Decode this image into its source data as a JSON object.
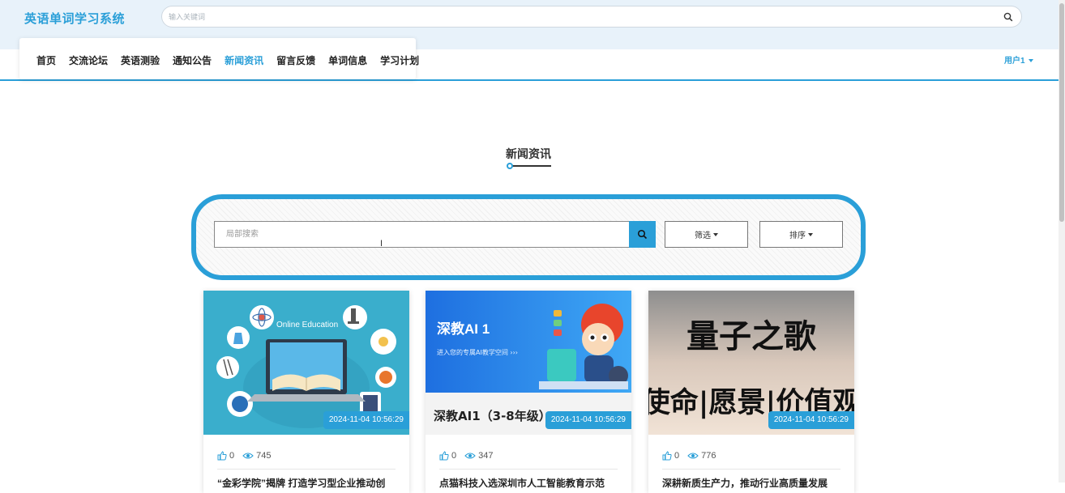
{
  "header": {
    "app_title": "英语单词学习系统",
    "search_placeholder": "输入关键词"
  },
  "nav": {
    "items": [
      {
        "label": "首页",
        "active": false
      },
      {
        "label": "交流论坛",
        "active": false
      },
      {
        "label": "英语测验",
        "active": false
      },
      {
        "label": "通知公告",
        "active": false
      },
      {
        "label": "新闻资讯",
        "active": true
      },
      {
        "label": "留言反馈",
        "active": false
      },
      {
        "label": "单词信息",
        "active": false
      },
      {
        "label": "学习计划",
        "active": false
      }
    ],
    "user_label": "用户1"
  },
  "section": {
    "title": "新闻资讯"
  },
  "filter": {
    "search_placeholder": "局部搜索",
    "filter_label": "筛选",
    "sort_label": "排序"
  },
  "cards": [
    {
      "date": "2024-11-04 10:56:29",
      "likes": "0",
      "views": "745",
      "title": "“金彩学院”揭牌 打造学习型企业推动创",
      "image_caption": "Online Education"
    },
    {
      "date": "2024-11-04 10:56:29",
      "likes": "0",
      "views": "347",
      "title": "点猫科技入选深圳市人工智能教育示范",
      "image_caption": "深教AI 1",
      "image_sub": "进入您的专属AI教学空间 ›››",
      "image_footer": "深教AI1（3-8年级）"
    },
    {
      "date": "2024-11-04 10:56:29",
      "likes": "0",
      "views": "776",
      "title": "深耕新质生产力，推动行业高质量发展",
      "image_line1": "量子之歌",
      "image_line2": "使命|愿景|价值观"
    }
  ],
  "colors": {
    "accent": "#2a9fd8",
    "header_bg": "#e8f2fa"
  }
}
